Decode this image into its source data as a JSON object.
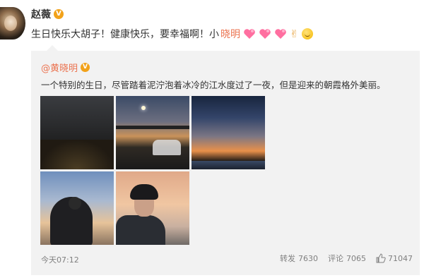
{
  "post": {
    "author": "赵薇",
    "text_prefix": "生日快乐大胡子！健康快乐，要幸福啊！小",
    "mention": "晓明"
  },
  "repost": {
    "author": "@黄晓明",
    "text": "一个特别的生日，尽管踏着泥泞泡着冰冷的江水度过了一夜，但是迎来的朝霞格外美丽。",
    "photos": [
      "dusk-crowd",
      "bridge-lamp",
      "sunset-river",
      "man-seated-dusk",
      "man-beanie-portrait"
    ],
    "timestamp": "今天07:12",
    "actions": {
      "repost_label": "转发",
      "repost_count": "7630",
      "comment_label": "评论",
      "comment_count": "7065",
      "like_count": "71047"
    }
  },
  "colors": {
    "link": "#eb7350",
    "badge": "#f2a21a",
    "repost_bg": "#f2f2f2",
    "meta_text": "#808080"
  },
  "icons": [
    "verified-badge",
    "heart-emoji",
    "victory-hand-emoji",
    "smile-emoji",
    "like-icon"
  ]
}
